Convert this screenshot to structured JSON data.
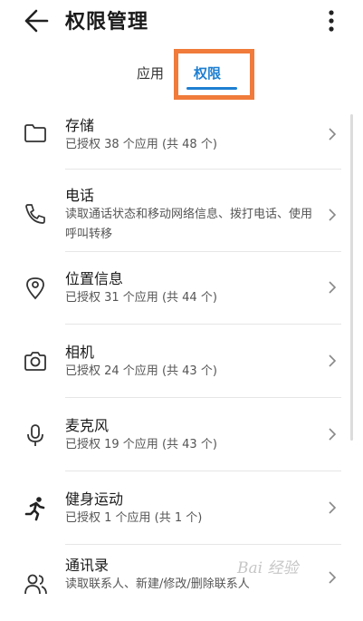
{
  "appbar": {
    "title": "权限管理"
  },
  "tabs": [
    {
      "label": "应用"
    },
    {
      "label": "权限"
    }
  ],
  "items": [
    {
      "title": "存储",
      "subtitle": "已授权 38 个应用 (共 48 个)",
      "icon": "folder-icon"
    },
    {
      "title": "电话",
      "subtitle": "读取通话状态和移动网络信息、拨打电话、使用呼叫转移",
      "icon": "phone-icon"
    },
    {
      "title": "位置信息",
      "subtitle": "已授权 31 个应用 (共 44 个)",
      "icon": "location-pin-icon"
    },
    {
      "title": "相机",
      "subtitle": "已授权 24 个应用 (共 43 个)",
      "icon": "camera-icon"
    },
    {
      "title": "麦克风",
      "subtitle": "已授权 19 个应用 (共 43 个)",
      "icon": "microphone-icon"
    },
    {
      "title": "健身运动",
      "subtitle": "已授权 1 个应用 (共 1 个)",
      "icon": "running-person-icon"
    },
    {
      "title": "通讯录",
      "subtitle": "读取联系人、新建/修改/删除联系人",
      "icon": "contacts-icon"
    }
  ],
  "watermark": {
    "text": "Bai 经验"
  },
  "colors": {
    "accent": "#1e7fd1",
    "highlight": "#f07b3a"
  }
}
